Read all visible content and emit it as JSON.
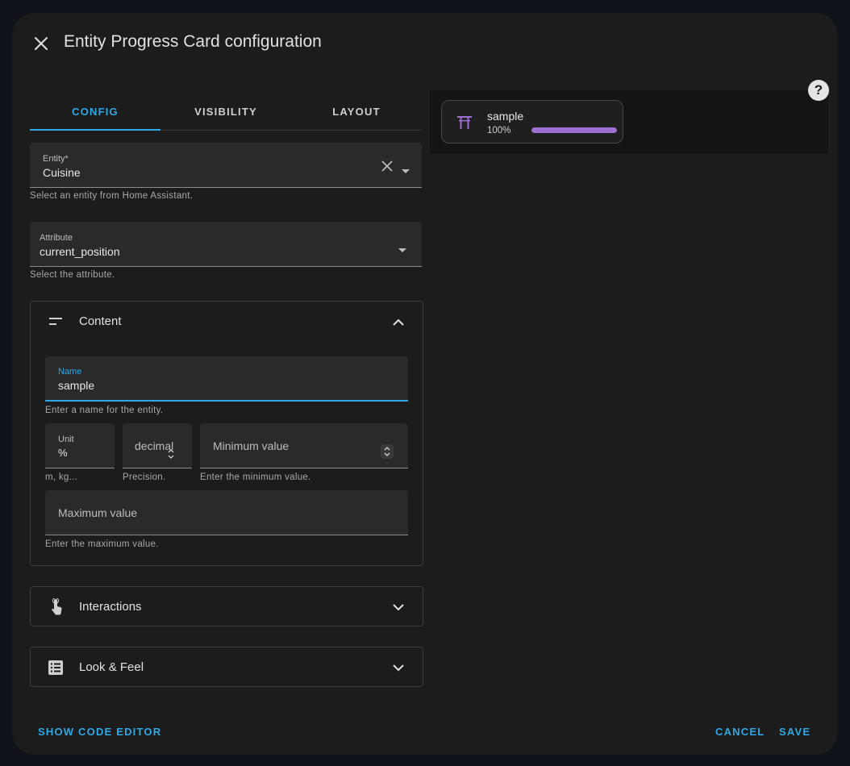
{
  "dialog": {
    "title": "Entity Progress Card configuration",
    "close_icon": "close-icon",
    "help_icon_label": "?"
  },
  "tabs": [
    {
      "label": "CONFIG",
      "active": true
    },
    {
      "label": "VISIBILITY",
      "active": false
    },
    {
      "label": "LAYOUT",
      "active": false
    }
  ],
  "entity": {
    "label": "Entity*",
    "value": "Cuisine",
    "helper": "Select an entity from Home Assistant."
  },
  "attribute": {
    "label": "Attribute",
    "value": "current_position",
    "helper": "Select the attribute."
  },
  "content": {
    "title": "Content",
    "icon": "short-text-icon",
    "expanded": true,
    "name": {
      "label": "Name",
      "value": "sample",
      "helper": "Enter a name for the entity."
    },
    "unit": {
      "label": "Unit",
      "value": "%",
      "helper": "m, kg..."
    },
    "decimal": {
      "placeholder": "decimal",
      "helper": "Precision."
    },
    "min": {
      "placeholder": "Minimum value",
      "helper": "Enter the minimum value."
    },
    "max": {
      "placeholder": "Maximum value",
      "helper": "Enter the maximum value."
    }
  },
  "interactions": {
    "title": "Interactions",
    "icon": "gesture-tap-icon",
    "expanded": false
  },
  "look_feel": {
    "title": "Look & Feel",
    "icon": "list-box-icon",
    "expanded": false
  },
  "preview": {
    "name": "sample",
    "percent_text": "100%",
    "progress": 1.0,
    "icon": "torii-gate-icon",
    "bar_color": "#9c6fd0"
  },
  "footer": {
    "show_code_editor": "SHOW CODE EDITOR",
    "cancel": "CANCEL",
    "save": "SAVE"
  },
  "colors": {
    "accent": "#2fa8e6",
    "background": "#1c1c1c"
  }
}
